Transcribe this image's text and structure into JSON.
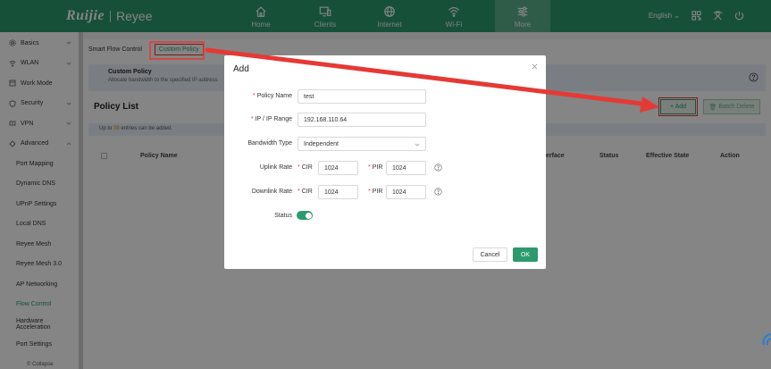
{
  "brand": {
    "name": "Ruijie",
    "product": "Reyee"
  },
  "nav": {
    "tabs": [
      {
        "label": "Home",
        "icon": "home-icon"
      },
      {
        "label": "Clients",
        "icon": "monitor-icon"
      },
      {
        "label": "Internet",
        "icon": "globe-icon"
      },
      {
        "label": "Wi-Fi",
        "icon": "wifi-icon"
      },
      {
        "label": "More",
        "icon": "sliders-icon"
      }
    ],
    "active": "More",
    "language": "English"
  },
  "sidebar": {
    "items": [
      {
        "label": "Basics",
        "icon": "gear-icon"
      },
      {
        "label": "WLAN",
        "icon": "wifi-icon"
      },
      {
        "label": "Work Mode",
        "icon": "workmode-icon"
      },
      {
        "label": "Security",
        "icon": "shield-icon"
      },
      {
        "label": "VPN",
        "icon": "vpn-icon"
      },
      {
        "label": "Advanced",
        "icon": "advanced-icon"
      }
    ],
    "subitems": [
      "Port Mapping",
      "Dynamic DNS",
      "UPnP Settings",
      "Local DNS",
      "Reyee Mesh",
      "Reyee Mesh 3.0",
      "AP Networking",
      "Flow Control",
      "Hardware Acceleration",
      "Port Settings"
    ],
    "active_sub": "Flow Control",
    "collapse": "Collapse"
  },
  "main": {
    "tabs": [
      "Smart Flow Control",
      "Custom Policy"
    ],
    "info_title": "Custom Policy",
    "info_text": "Allocate bandwidth to the specified IP address",
    "list_title": "Policy List",
    "add_label": "+ Add",
    "batch_label": "Batch Delete",
    "upto_prefix": "Up to",
    "upto_count": "30",
    "upto_suffix": "entries can be added.",
    "columns": [
      "Policy Name",
      "erface",
      "Status",
      "Effective State",
      "Action"
    ]
  },
  "modal": {
    "title": "Add",
    "policy_name_label": "Policy Name",
    "policy_name_value": "test",
    "ip_label": "IP / IP Range",
    "ip_value": "192.168.110.64",
    "bw_type_label": "Bandwidth Type",
    "bw_type_value": "Independent",
    "uplink_label": "Uplink Rate",
    "downlink_label": "Downlink Rate",
    "cir_label": "CIR",
    "pir_label": "PIR",
    "uplink_cir": "1024",
    "uplink_pir": "1024",
    "downlink_cir": "1024",
    "downlink_pir": "1024",
    "status_label": "Status",
    "status_on": true,
    "cancel_label": "Cancel",
    "ok_label": "OK"
  },
  "colors": {
    "brand": "#2c9a6e",
    "annotation": "#e53935"
  }
}
